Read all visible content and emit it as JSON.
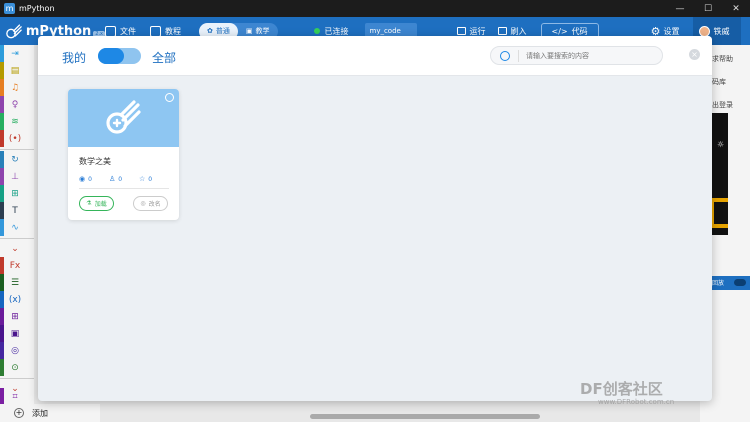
{
  "window": {
    "title": "mPython",
    "minimize": "—",
    "maximize": "☐",
    "close": "✕"
  },
  "app": {
    "name": "mPython",
    "version_badge": "2.x",
    "nav": [
      {
        "label": "文件"
      },
      {
        "label": "教程"
      }
    ],
    "mode": {
      "normal": "普通",
      "teaching": "教学"
    },
    "connection": "已连接",
    "filename": "my_code",
    "run": "运行",
    "flash": "刷入",
    "code": "代码",
    "settings": "设置",
    "user": "铁威"
  },
  "background_right": {
    "help": "求帮助",
    "library": "码库",
    "logout": "出登录",
    "bar_label": "回放"
  },
  "palette": {
    "add_label": "添加"
  },
  "modal": {
    "tab_mine": "我的",
    "tab_all": "全部",
    "search_placeholder": "请输入要搜索的内容",
    "close": "×",
    "cards": [
      {
        "title": "数学之美",
        "views": "0",
        "likes": "0",
        "stars": "0",
        "load_label": "加载",
        "rename_label": "改名"
      }
    ]
  },
  "watermark": {
    "main": "DF创客社区",
    "sub": "www.DFRobot.com.cn"
  },
  "colors": {
    "brand_blue": "#1e6fc0",
    "card_cover": "#8ec6f2",
    "green": "#35b55a"
  }
}
